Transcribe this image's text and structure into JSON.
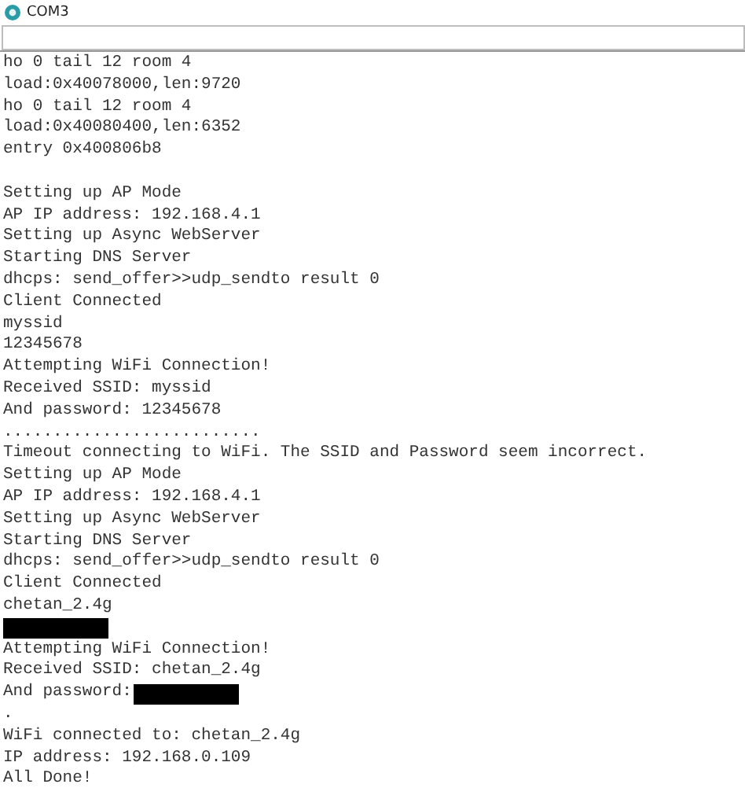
{
  "window": {
    "title": "COM3"
  },
  "output": [
    {
      "kind": "text",
      "text": "ho 0 tail 12 room 4"
    },
    {
      "kind": "text",
      "text": "load:0x40078000,len:9720"
    },
    {
      "kind": "text",
      "text": "ho 0 tail 12 room 4"
    },
    {
      "kind": "text",
      "text": "load:0x40080400,len:6352"
    },
    {
      "kind": "text",
      "text": "entry 0x400806b8"
    },
    {
      "kind": "blank"
    },
    {
      "kind": "text",
      "text": "Setting up AP Mode"
    },
    {
      "kind": "text",
      "text": "AP IP address: 192.168.4.1"
    },
    {
      "kind": "text",
      "text": "Setting up Async WebServer"
    },
    {
      "kind": "text",
      "text": "Starting DNS Server"
    },
    {
      "kind": "text",
      "text": "dhcps: send_offer>>udp_sendto result 0"
    },
    {
      "kind": "text",
      "text": "Client Connected"
    },
    {
      "kind": "text",
      "text": "myssid"
    },
    {
      "kind": "text",
      "text": "12345678"
    },
    {
      "kind": "text",
      "text": "Attempting WiFi Connection!"
    },
    {
      "kind": "text",
      "text": "Received SSID: myssid"
    },
    {
      "kind": "text",
      "text": "And password: 12345678"
    },
    {
      "kind": "text",
      "text": ".........................."
    },
    {
      "kind": "text",
      "text": "Timeout connecting to WiFi. The SSID and Password seem incorrect."
    },
    {
      "kind": "text",
      "text": "Setting up AP Mode"
    },
    {
      "kind": "text",
      "text": "AP IP address: 192.168.4.1"
    },
    {
      "kind": "text",
      "text": "Setting up Async WebServer"
    },
    {
      "kind": "text",
      "text": "Starting DNS Server"
    },
    {
      "kind": "text",
      "text": "dhcps: send_offer>>udp_sendto result 0"
    },
    {
      "kind": "text",
      "text": "Client Connected"
    },
    {
      "kind": "text",
      "text": "chetan_2.4g"
    },
    {
      "kind": "redacted"
    },
    {
      "kind": "text",
      "text": "Attempting WiFi Connection!"
    },
    {
      "kind": "text",
      "text": "Received SSID: chetan_2.4g"
    },
    {
      "kind": "redacted-after",
      "text": "And password:"
    },
    {
      "kind": "text",
      "text": "."
    },
    {
      "kind": "text",
      "text": "WiFi connected to: chetan_2.4g"
    },
    {
      "kind": "text",
      "text": "IP address: 192.168.0.109"
    },
    {
      "kind": "text",
      "text": "All Done!"
    }
  ]
}
